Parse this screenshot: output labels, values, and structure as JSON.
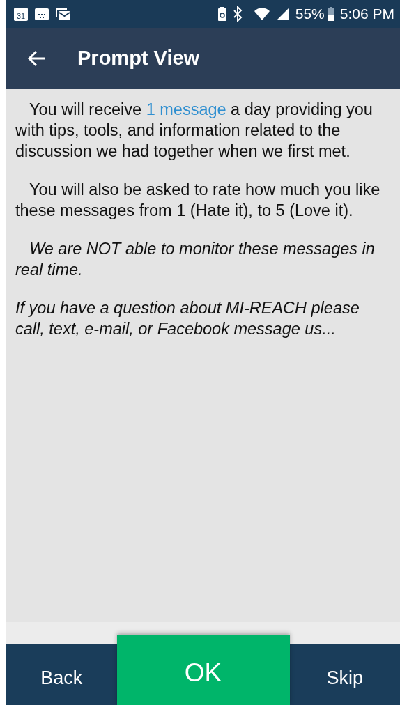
{
  "status_bar": {
    "calendar_day": "31",
    "battery": "55%",
    "time": "5:06 PM"
  },
  "app_bar": {
    "title": "Prompt View"
  },
  "paragraphs": [
    {
      "kind": "link",
      "before": "You will receive ",
      "link": "1 message",
      "after": " a day providing you with tips, tools, and information related to the discussion we had together when we first met."
    },
    {
      "kind": "plain",
      "text": "You will also be asked to rate how much you like these messages from 1 (Hate it), to 5 (Love it)."
    },
    {
      "kind": "italic",
      "text": "We are NOT able to monitor these messages in real time."
    },
    {
      "kind": "italic-flush",
      "text": "If you have a question about MI-REACH please call, text, e-mail, or Facebook message us..."
    }
  ],
  "buttons": [
    {
      "label": "Back",
      "kind": "plain"
    },
    {
      "label": "OK",
      "kind": "primary"
    },
    {
      "label": "Skip",
      "kind": "plain"
    }
  ]
}
